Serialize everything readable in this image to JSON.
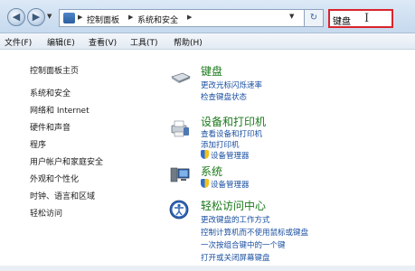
{
  "address_bar": {
    "crumbs": [
      "控制面板",
      "系统和安全"
    ],
    "search_value": "键盘"
  },
  "menu": [
    "文件(F)",
    "编辑(E)",
    "查看(V)",
    "工具(T)",
    "帮助(H)"
  ],
  "left_nav": {
    "home": "控制面板主页",
    "items": [
      "系统和安全",
      "网络和 Internet",
      "硬件和声音",
      "程序",
      "用户帐户和家庭安全",
      "外观和个性化",
      "时钟、语言和区域",
      "轻松访问"
    ]
  },
  "categories": [
    {
      "icon": "keyboard-icon",
      "title": "键盘",
      "links": [
        "更改光标闪烁速率",
        "检查键盘状态"
      ]
    },
    {
      "icon": "printer-icon",
      "title": "设备和打印机",
      "links": [
        "查看设备和打印机",
        "添加打印机"
      ],
      "shield_links": [
        "设备管理器"
      ]
    },
    {
      "icon": "computer-icon",
      "title": "系统",
      "shield_links": [
        "设备管理器"
      ]
    },
    {
      "icon": "ease-of-access-icon",
      "title": "轻松访问中心",
      "links": [
        "更改键盘的工作方式",
        "控制计算机而不使用鼠标或键盘",
        "一次按组合键中的一个键",
        "打开或关闭屏幕键盘"
      ]
    }
  ],
  "colors": {
    "category_title": "#1b7a1b",
    "link": "#1a4fa0",
    "search_highlight": "#d9242c"
  }
}
